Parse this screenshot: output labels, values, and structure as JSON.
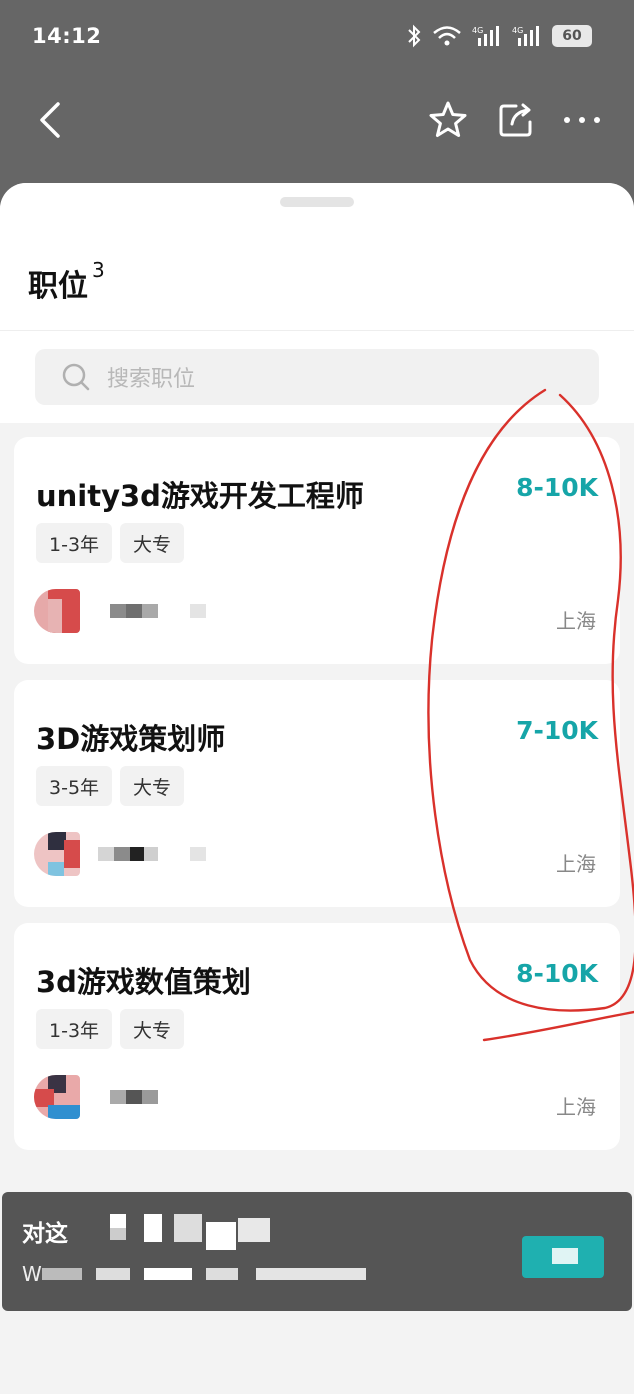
{
  "status_bar": {
    "time": "14:12",
    "icons": [
      "bluetooth-icon",
      "wifi-icon",
      "signal-4g-icon",
      "signal-4g-icon"
    ],
    "battery": "60"
  },
  "nav": {
    "icons": [
      "back-icon",
      "star-icon",
      "share-icon",
      "more-icon"
    ]
  },
  "sheet": {
    "title": "职位",
    "count": "3",
    "search_placeholder": "搜索职位"
  },
  "jobs": [
    {
      "title": "unity3d游戏开发工程师",
      "salary": "8-10K",
      "tags": [
        "1-3年",
        "大专"
      ],
      "city": "上海"
    },
    {
      "title": "3D游戏策划师",
      "salary": "7-10K",
      "tags": [
        "3-5年",
        "大专"
      ],
      "city": "上海"
    },
    {
      "title": "3d游戏数值策划",
      "salary": "8-10K",
      "tags": [
        "1-3年",
        "大专"
      ],
      "city": "上海"
    }
  ],
  "banner": {
    "line1": "对这",
    "line2": "W"
  },
  "colors": {
    "accent": "#16a5a8",
    "overlay": "#666666",
    "annotation": "#d9312b"
  }
}
